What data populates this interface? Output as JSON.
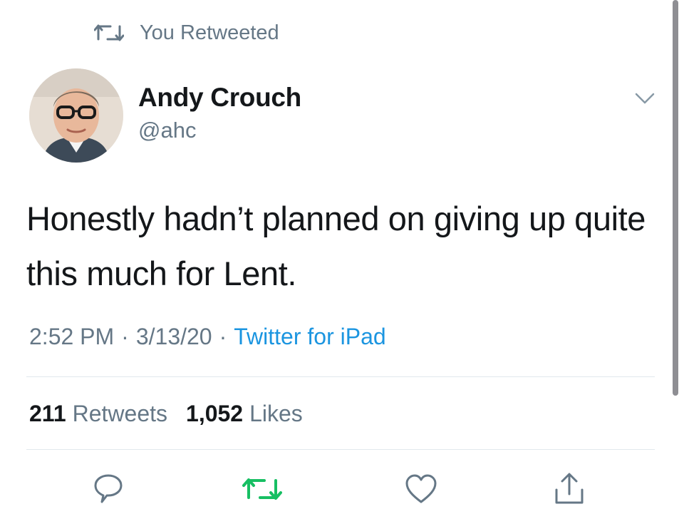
{
  "retweet_context": {
    "text": "You Retweeted",
    "icon": "retweet-icon"
  },
  "author": {
    "display_name": "Andy Crouch",
    "handle": "@ahc"
  },
  "tweet": {
    "text": "Honestly hadn’t planned on giving up quite this much for Lent."
  },
  "meta": {
    "time": "2:52 PM",
    "separator": "·",
    "date": "3/13/20",
    "source": "Twitter for iPad"
  },
  "stats": {
    "retweets_count": "211",
    "retweets_label": "Retweets",
    "likes_count": "1,052",
    "likes_label": "Likes"
  },
  "actions": [
    "reply-icon",
    "retweet-icon",
    "like-icon",
    "share-icon"
  ],
  "colors": {
    "text": "#14171a",
    "secondary": "#657786",
    "link": "#1b95e0",
    "retweet_green": "#17bf63",
    "divider": "#e1e8ed"
  }
}
